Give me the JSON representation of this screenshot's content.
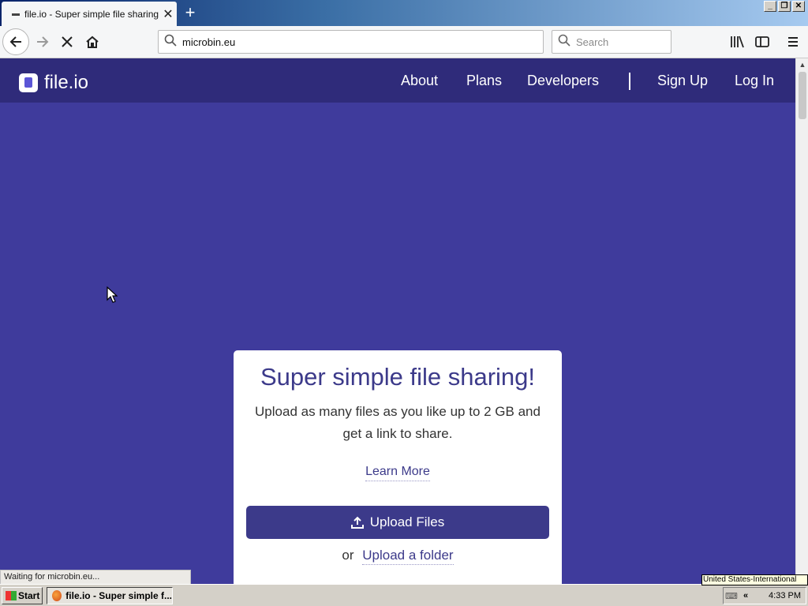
{
  "browser": {
    "tab": {
      "title": "file.io - Super simple file sharing",
      "close_glyph": "✕"
    },
    "new_tab_glyph": "+",
    "window_controls": [
      "_",
      "❐",
      "✕"
    ],
    "url": "microbin.eu",
    "search_placeholder": "Search"
  },
  "site": {
    "logo_text": "file.io",
    "nav": {
      "about": "About",
      "plans": "Plans",
      "developers": "Developers",
      "sign_up": "Sign Up",
      "log_in": "Log In"
    }
  },
  "card": {
    "title": "Super simple file sharing!",
    "description": "Upload as many files as you like up to 2 GB and get a link to share.",
    "learn_more": "Learn More",
    "upload_files": "Upload Files",
    "or_text": "or",
    "upload_folder": "Upload a folder"
  },
  "status_text": "Waiting for microbin.eu...",
  "taskbar": {
    "start_label": "Start",
    "task_label": "file.io - Super simple f...",
    "language_tooltip": "United States-International",
    "clock": "4:33 PM"
  },
  "colors": {
    "brand_purple": "#3f3b9c",
    "header": "#2f2b7a",
    "button": "#3c3a8a"
  }
}
